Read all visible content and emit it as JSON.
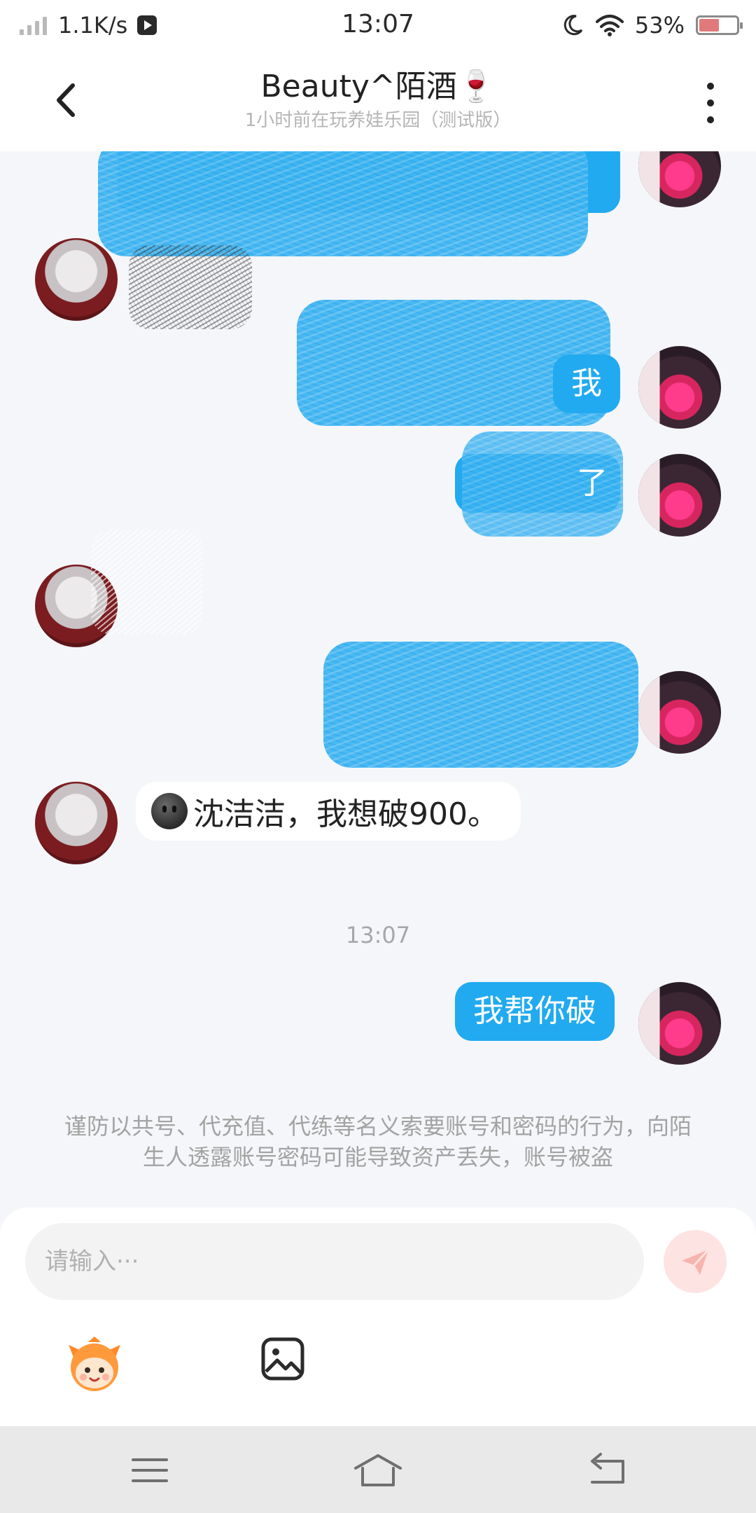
{
  "status_bar": {
    "net_speed": "1.1K/s",
    "time": "13:07",
    "battery_percent": "53%",
    "battery_level": 0.53,
    "icons": [
      "signal-icon",
      "media-play-icon",
      "moon-icon",
      "wifi-icon",
      "battery-icon"
    ]
  },
  "header": {
    "title": "Beauty^陌酒🍷",
    "subtitle": "1小时前在玩养娃乐园（测试版）",
    "icons": [
      "back-arrow-icon",
      "more-vertical-icon"
    ]
  },
  "chat": {
    "messages": [
      {
        "side": "right",
        "text": "",
        "redacted": true
      },
      {
        "side": "left",
        "text": "",
        "redacted": true
      },
      {
        "side": "right",
        "text": "我",
        "redacted": true
      },
      {
        "side": "right",
        "text": "了",
        "redacted": true
      },
      {
        "side": "left",
        "text": "",
        "redacted": true
      },
      {
        "side": "right",
        "text": "",
        "redacted": true
      },
      {
        "side": "left",
        "text": "沈洁洁，我想破900。",
        "emoji": "dark-smiley-icon"
      },
      {
        "side": "right",
        "text": "我帮你破"
      }
    ],
    "timestamp": "13:07",
    "security_notice": "谨防以共号、代充值、代练等名义索要账号和密码的行为，向陌生人透露账号密码可能导致资产丢失，账号被盗"
  },
  "composer": {
    "placeholder": "请输入···",
    "value": "",
    "icons": [
      "send-icon",
      "emoji-sticker-icon",
      "image-icon"
    ]
  },
  "nav_bar": {
    "icons": [
      "menu-icon",
      "home-icon",
      "back-icon"
    ]
  },
  "colors": {
    "accent_blue": "#21aaf0",
    "background": "#f4f6f9",
    "send_button": "#fde3e1"
  }
}
